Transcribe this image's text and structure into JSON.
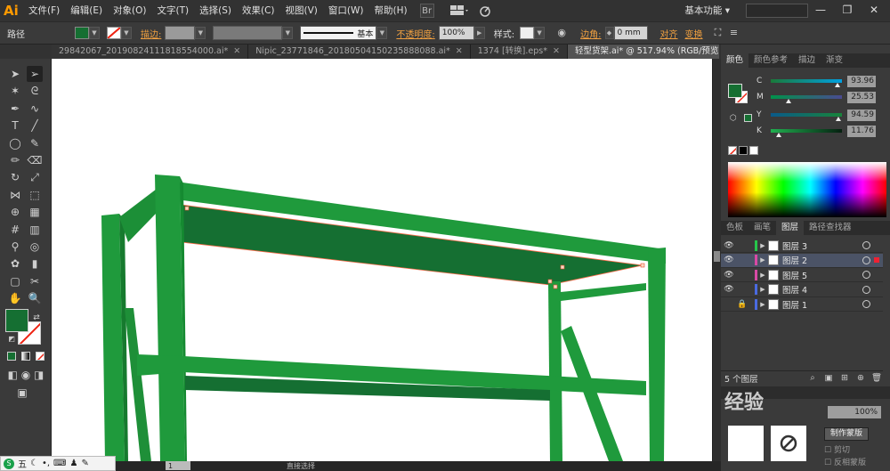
{
  "app": {
    "logo": "Ai"
  },
  "menu": [
    "文件(F)",
    "编辑(E)",
    "对象(O)",
    "文字(T)",
    "选择(S)",
    "效果(C)",
    "视图(V)",
    "窗口(W)",
    "帮助(H)"
  ],
  "menubar_icons": {
    "bridge": "Br",
    "arrange": "arrange-docs-icon",
    "gpu": "gpu-icon"
  },
  "workspace": "基本功能",
  "window_controls": {
    "minimize": "—",
    "restore": "❐",
    "close": "✕"
  },
  "control": {
    "selection_label": "路径",
    "fill_color": "#156f32",
    "stroke_label": "描边:",
    "stroke_profile": "基本",
    "opacity_label": "不透明度:",
    "opacity_value": "100%",
    "style_label": "样式:",
    "corner_label": "边角:",
    "corner_value": "0 mm",
    "align_label": "对齐",
    "transform_label": "变换"
  },
  "tabs": [
    {
      "label": "29842067_20190824111818554000.ai*",
      "active": false
    },
    {
      "label": "Nipic_23771846_20180504150235888088.ai*",
      "active": false
    },
    {
      "label": "1374 [转换].eps*",
      "active": false
    },
    {
      "label": "轻型货架.ai* @ 517.94% (RGB/预览)",
      "active": true
    }
  ],
  "tab_close": "✕",
  "toolbar": {
    "fill_color": "#156f32",
    "tools": [
      "selection-tool",
      "direct-selection-tool",
      "magic-wand-tool",
      "lasso-tool",
      "pen-tool",
      "curvature-tool",
      "type-tool",
      "line-tool",
      "ellipse-tool",
      "paintbrush-tool",
      "pencil-tool",
      "eraser-tool",
      "rotate-tool",
      "scale-tool",
      "width-tool",
      "free-transform-tool",
      "shape-builder-tool",
      "perspective-grid-tool",
      "mesh-tool",
      "gradient-tool",
      "eyedropper-tool",
      "blend-tool",
      "symbol-sprayer-tool",
      "column-graph-tool",
      "artboard-tool",
      "slice-tool",
      "hand-tool",
      "zoom-tool"
    ]
  },
  "color_panel": {
    "tabs": [
      "颜色",
      "颜色参考",
      "描边",
      "渐变"
    ],
    "channels": [
      {
        "label": "C",
        "value": "93.96",
        "fraction": 0.94,
        "track": "linear-gradient(to right,#1a7a3a,#00a0e0)"
      },
      {
        "label": "M",
        "value": "25.53",
        "fraction": 0.255,
        "track": "linear-gradient(to right,#00924a,#4a4a90)"
      },
      {
        "label": "Y",
        "value": "94.59",
        "fraction": 0.946,
        "track": "linear-gradient(to right,#0a5a8a,#18843a)"
      },
      {
        "label": "K",
        "value": "11.76",
        "fraction": 0.118,
        "track": "linear-gradient(to right,#20b050,#052010)"
      }
    ]
  },
  "layers_panel": {
    "tabs": [
      "色板",
      "画笔",
      "图层",
      "路径查找器"
    ],
    "layers": [
      {
        "name": "图层 3",
        "color": "#26c64a",
        "visible": true,
        "locked": false,
        "selected": false
      },
      {
        "name": "图层 2",
        "color": "#d84aa5",
        "visible": true,
        "locked": false,
        "selected": true
      },
      {
        "name": "图层 5",
        "color": "#d84aa5",
        "visible": true,
        "locked": false,
        "selected": false
      },
      {
        "name": "图层 4",
        "color": "#4a6ae0",
        "visible": true,
        "locked": false,
        "selected": false
      },
      {
        "name": "图层 1",
        "color": "#4a6ae0",
        "visible": false,
        "locked": true,
        "selected": false
      }
    ],
    "footer": "5 个图层"
  },
  "bottom_panel": {
    "zoom": "100%",
    "buttons": [
      "制作蒙版",
      "反相蒙版"
    ],
    "clip_label": "剪切"
  },
  "status": {
    "tool_name": "直接选择",
    "artboard": "1"
  },
  "ime": {
    "mode": "五"
  },
  "watermark": "经验"
}
